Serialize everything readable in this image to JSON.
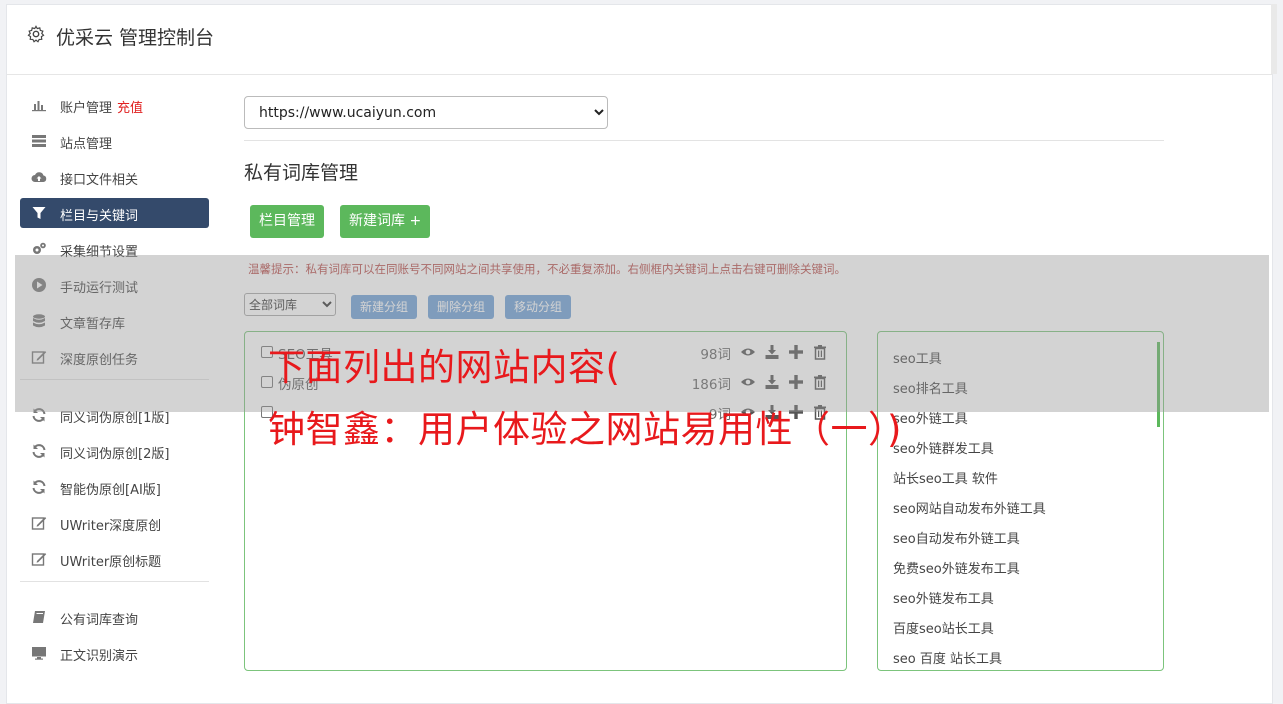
{
  "header": {
    "title": "优采云 管理控制台",
    "icon": "gear-icon"
  },
  "sidebar": {
    "groups": [
      [
        {
          "label": "账户管理",
          "extra": "充值",
          "icon": "bar-chart-icon"
        },
        {
          "label": "站点管理",
          "icon": "server-icon"
        },
        {
          "label": "接口文件相关",
          "icon": "cloud-upload-icon"
        },
        {
          "label": "栏目与关键词",
          "icon": "filter-icon",
          "active": true
        },
        {
          "label": "采集细节设置",
          "icon": "gears-icon"
        },
        {
          "label": "手动运行测试",
          "icon": "play-circle-icon"
        },
        {
          "label": "文章暂存库",
          "icon": "database-icon"
        },
        {
          "label": "深度原创任务",
          "icon": "edit-icon"
        }
      ],
      [
        {
          "label": "同义词伪原创[1版]",
          "icon": "refresh-icon"
        },
        {
          "label": "同义词伪原创[2版]",
          "icon": "refresh-icon"
        },
        {
          "label": "智能伪原创[AI版]",
          "icon": "refresh-icon"
        },
        {
          "label": "UWriter深度原创",
          "icon": "edit-icon"
        },
        {
          "label": "UWriter原创标题",
          "icon": "edit-icon"
        }
      ],
      [
        {
          "label": "公有词库查询",
          "icon": "book-icon"
        },
        {
          "label": "正文识别演示",
          "icon": "monitor-icon"
        }
      ]
    ]
  },
  "main": {
    "site_select": "https://www.ucaiyun.com",
    "page_title": "私有词库管理",
    "btn_column_manage": "栏目管理",
    "btn_new_library": "新建词库 +",
    "tip": "温馨提示：私有词库可以在同账号不同网站之间共享使用，不必重复添加。右侧框内关键词上点击右键可删除关键词。",
    "group_select": "全部词库",
    "btn_new_group": "新建分组",
    "btn_delete_group": "删除分组",
    "btn_move_group": "移动分组",
    "libraries": [
      {
        "name": "SEO工具",
        "count": "98词"
      },
      {
        "name": "伪原创",
        "count": "186词"
      },
      {
        "name": "",
        "count": "9词"
      }
    ],
    "keywords": [
      "seo工具",
      "seo排名工具",
      "seo外链工具",
      "seo外链群发工具",
      "站长seo工具 软件",
      "seo网站自动发布外链工具",
      "seo自动发布外链工具",
      "免费seo外链发布工具",
      "seo外链发布工具",
      "百度seo站长工具",
      "seo 百度 站长工具"
    ]
  },
  "overlay": {
    "line1": "下面列出的网站内容(",
    "line2": "钟智鑫：用户体验之网站易用性（一）)"
  },
  "colors": {
    "accent_green": "#5cb85c",
    "active_nav": "#344a6b",
    "overlay_text": "#e8191c"
  }
}
